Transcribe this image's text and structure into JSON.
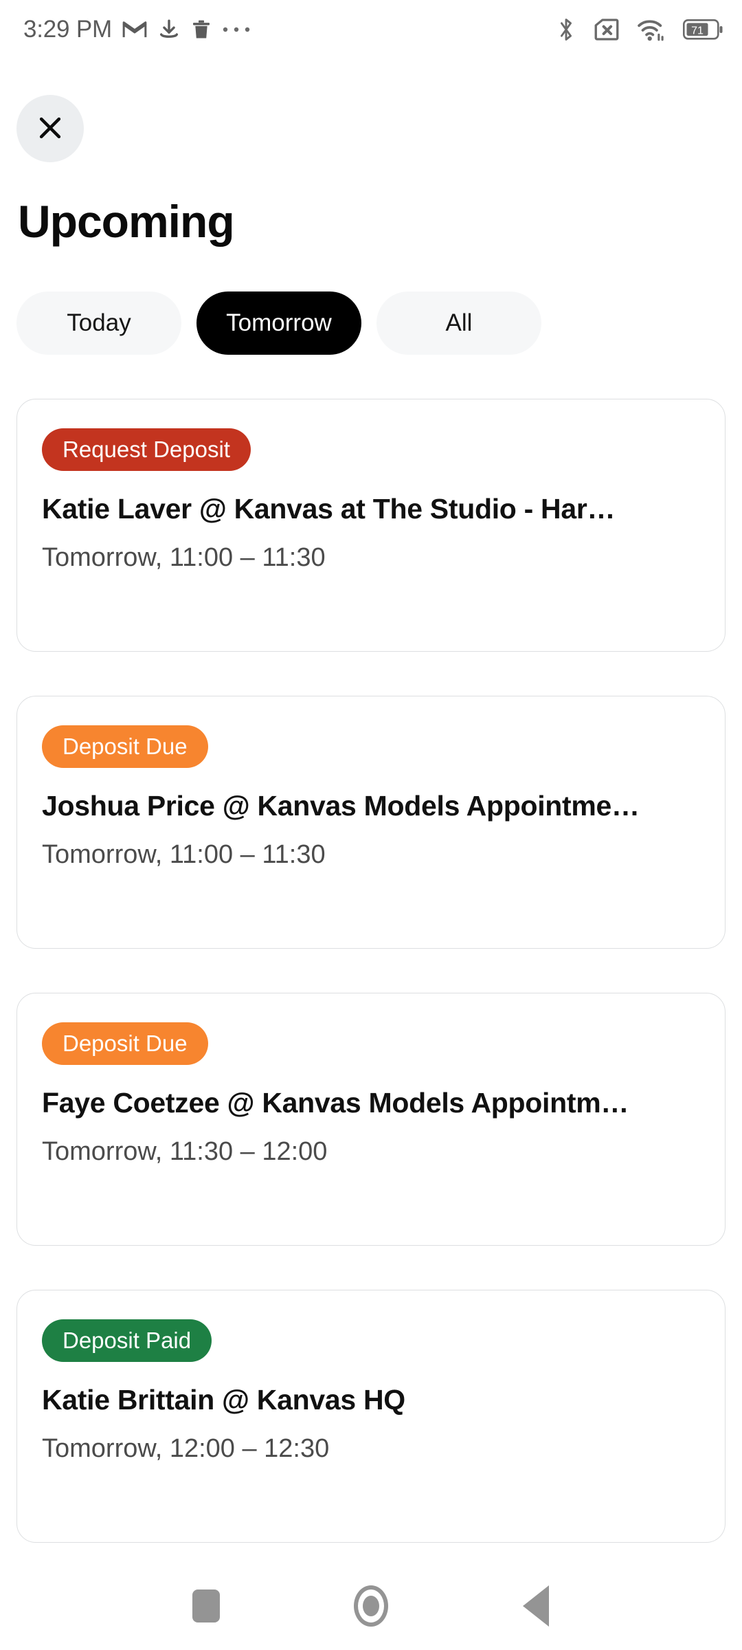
{
  "status_bar": {
    "time": "3:29 PM",
    "left_icons": [
      "gmail-icon",
      "download-icon",
      "trash-icon",
      "overflow-dots-icon"
    ],
    "right_icons": [
      "bluetooth-icon",
      "no-sim-icon",
      "wifi-icon"
    ],
    "battery_percent": "71"
  },
  "header": {
    "close_label": "✕",
    "title": "Upcoming"
  },
  "tabs": [
    {
      "label": "Today",
      "selected": false
    },
    {
      "label": "Tomorrow",
      "selected": true
    },
    {
      "label": "All",
      "selected": false
    }
  ],
  "colors": {
    "badge_request_deposit": "#c3341f",
    "badge_deposit_due": "#f7852f",
    "badge_deposit_paid": "#1e8044",
    "tab_selected_bg": "#000000",
    "tab_bg": "#f6f7f8",
    "card_border": "#dddfe1"
  },
  "appointments": [
    {
      "badge": "Request Deposit",
      "badge_color": "#c3341f",
      "title": "Katie   Laver @ Kanvas at The Studio - Har…",
      "time": "Tomorrow, 11:00 –  11:30"
    },
    {
      "badge": "Deposit Due",
      "badge_color": "#f7852f",
      "title": "Joshua Price @ Kanvas Models Appointme…",
      "time": "Tomorrow, 11:00 –  11:30"
    },
    {
      "badge": "Deposit Due",
      "badge_color": "#f7852f",
      "title": "Faye  Coetzee @ Kanvas Models Appointm…",
      "time": "Tomorrow, 11:30 –  12:00"
    },
    {
      "badge": "Deposit Paid",
      "badge_color": "#1e8044",
      "title": "Katie Brittain @ Kanvas HQ",
      "time": "Tomorrow, 12:00 –  12:30"
    }
  ],
  "nav_bar": {
    "recents_label": "recents",
    "home_label": "home",
    "back_label": "back"
  }
}
